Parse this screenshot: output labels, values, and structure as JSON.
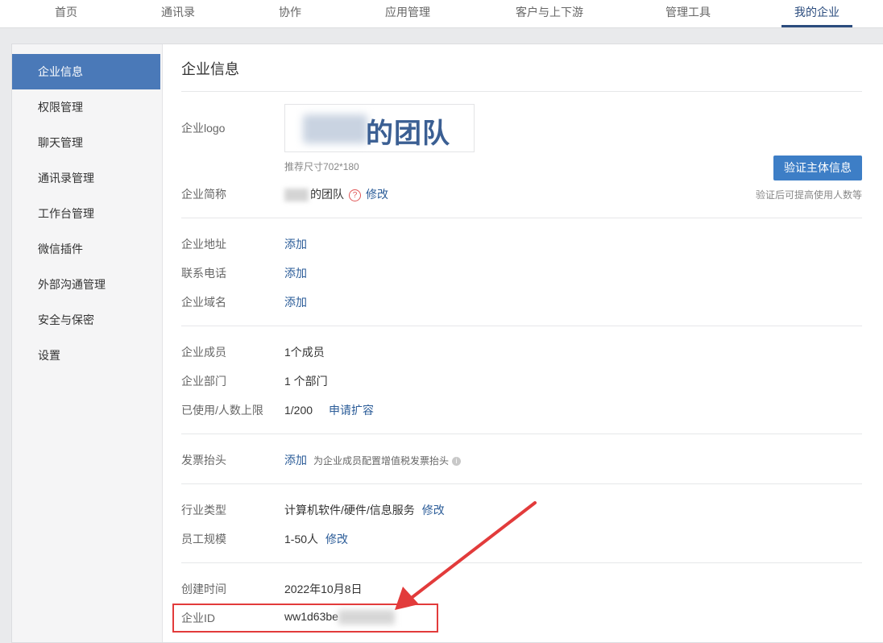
{
  "topnav": {
    "tabs": [
      {
        "label": "首页"
      },
      {
        "label": "通讯录"
      },
      {
        "label": "协作"
      },
      {
        "label": "应用管理"
      },
      {
        "label": "客户与上下游"
      },
      {
        "label": "管理工具"
      },
      {
        "label": "我的企业",
        "active": true
      }
    ]
  },
  "sidebar": {
    "items": [
      {
        "label": "企业信息",
        "active": true
      },
      {
        "label": "权限管理"
      },
      {
        "label": "聊天管理"
      },
      {
        "label": "通讯录管理"
      },
      {
        "label": "工作台管理"
      },
      {
        "label": "微信插件"
      },
      {
        "label": "外部沟通管理"
      },
      {
        "label": "安全与保密"
      },
      {
        "label": "设置"
      }
    ]
  },
  "main": {
    "title": "企业信息",
    "logo": {
      "label": "企业logo",
      "text": "的团队",
      "hint": "推荐尺寸702*180"
    },
    "verify": {
      "button": "验证主体信息",
      "note": "验证后可提高使用人数等"
    },
    "short_name": {
      "label": "企业简称",
      "value": "的团队",
      "help_icon": "?",
      "edit": "修改"
    },
    "address": {
      "label": "企业地址",
      "action": "添加"
    },
    "phone": {
      "label": "联系电话",
      "action": "添加"
    },
    "domain": {
      "label": "企业域名",
      "action": "添加"
    },
    "members": {
      "label": "企业成员",
      "value": "1个成员"
    },
    "departments": {
      "label": "企业部门",
      "value": "1 个部门"
    },
    "usage": {
      "label": "已使用/人数上限",
      "value": "1/200",
      "action": "申请扩容"
    },
    "invoice": {
      "label": "发票抬头",
      "action": "添加",
      "desc": "为企业成员配置增值税发票抬头",
      "info_icon": "i"
    },
    "industry": {
      "label": "行业类型",
      "value": "计算机软件/硬件/信息服务",
      "edit": "修改"
    },
    "size": {
      "label": "员工规模",
      "value": "1-50人",
      "edit": "修改"
    },
    "created": {
      "label": "创建时间",
      "value": "2022年10月8日"
    },
    "corp_id": {
      "label": "企业ID",
      "value": "ww1d63be"
    }
  },
  "annotation": {
    "color": "#e23b3b"
  }
}
